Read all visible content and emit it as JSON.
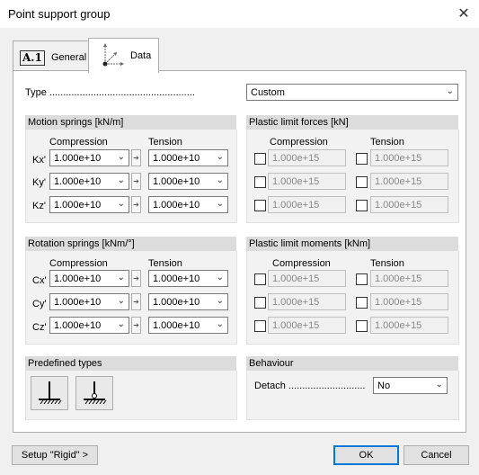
{
  "window": {
    "title": "Point support group",
    "close_glyph": "✕"
  },
  "tabs": [
    {
      "label": "General",
      "badge": "A.1"
    },
    {
      "label": "Data"
    }
  ],
  "type_row": {
    "label": "Type",
    "value": "Custom"
  },
  "motion_springs": {
    "title": "Motion springs [kN/m]",
    "col_compression": "Compression",
    "col_tension": "Tension",
    "rows": [
      {
        "label": "Kx'",
        "compression": "1.000e+10",
        "tension": "1.000e+10"
      },
      {
        "label": "Ky'",
        "compression": "1.000e+10",
        "tension": "1.000e+10"
      },
      {
        "label": "Kz'",
        "compression": "1.000e+10",
        "tension": "1.000e+10"
      }
    ]
  },
  "plastic_forces": {
    "title": "Plastic limit forces [kN]",
    "col_compression": "Compression",
    "col_tension": "Tension",
    "rows": [
      {
        "compression": "1.000e+15",
        "tension": "1.000e+15"
      },
      {
        "compression": "1.000e+15",
        "tension": "1.000e+15"
      },
      {
        "compression": "1.000e+15",
        "tension": "1.000e+15"
      }
    ]
  },
  "rotation_springs": {
    "title": "Rotation springs [kNm/°]",
    "col_compression": "Compression",
    "col_tension": "Tension",
    "rows": [
      {
        "label": "Cx'",
        "compression": "1.000e+10",
        "tension": "1.000e+10"
      },
      {
        "label": "Cy'",
        "compression": "1.000e+10",
        "tension": "1.000e+10"
      },
      {
        "label": "Cz'",
        "compression": "1.000e+10",
        "tension": "1.000e+10"
      }
    ]
  },
  "plastic_moments": {
    "title": "Plastic limit moments [kNm]",
    "col_compression": "Compression",
    "col_tension": "Tension",
    "rows": [
      {
        "compression": "1.000e+15",
        "tension": "1.000e+15"
      },
      {
        "compression": "1.000e+15",
        "tension": "1.000e+15"
      },
      {
        "compression": "1.000e+15",
        "tension": "1.000e+15"
      }
    ]
  },
  "predefined": {
    "title": "Predefined types",
    "icons": [
      "fixed-support-icon",
      "pinned-support-icon"
    ]
  },
  "behaviour": {
    "title": "Behaviour",
    "detach_label": "Detach",
    "detach_value": "No"
  },
  "footer": {
    "setup_label": "Setup \"Rigid\" >",
    "ok_label": "OK",
    "cancel_label": "Cancel"
  },
  "glyphs": {
    "chevron": "⌄",
    "arrow": "➔"
  }
}
